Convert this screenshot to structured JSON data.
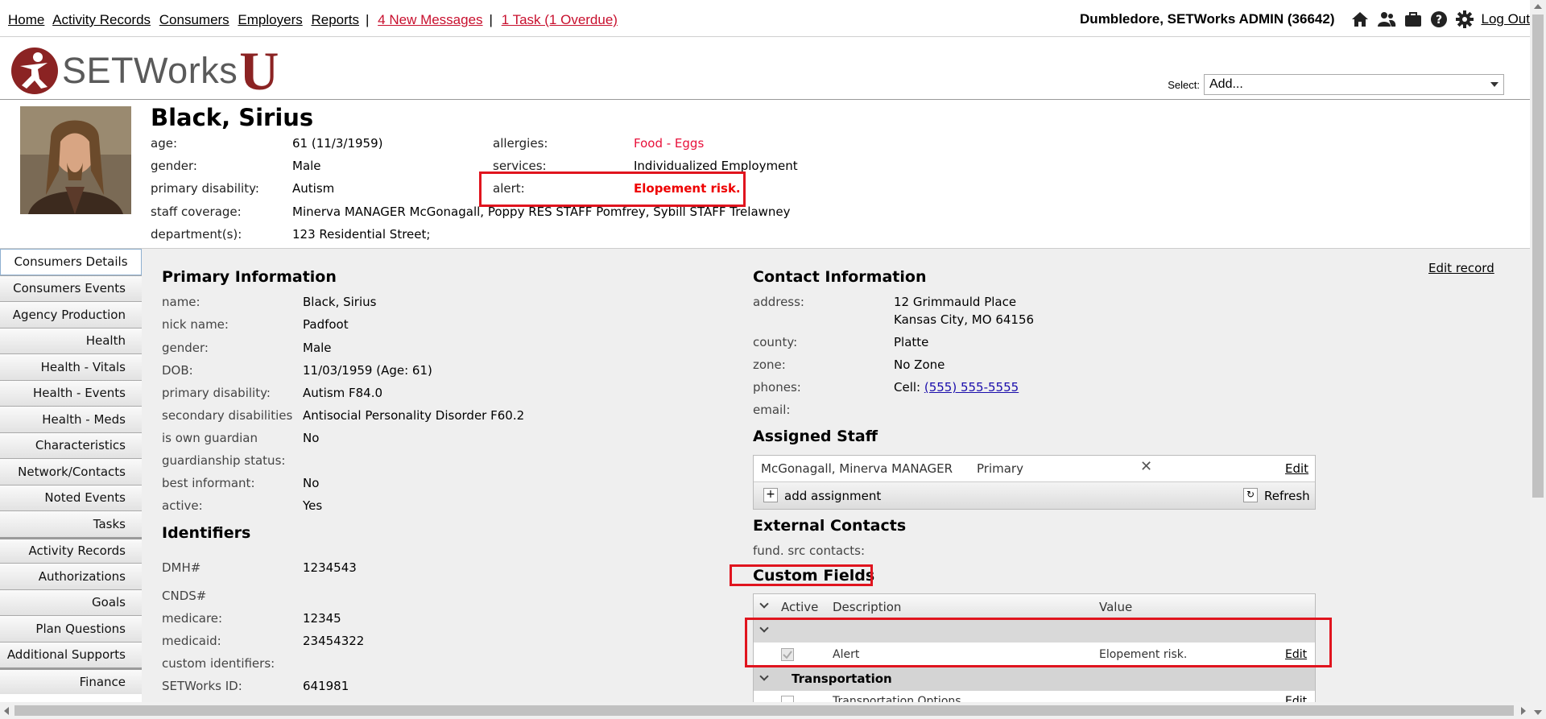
{
  "topnav": {
    "links": [
      "Home",
      "Activity Records",
      "Consumers",
      "Employers",
      "Reports"
    ],
    "messages": "4 New Messages",
    "tasks": "1 Task (1 Overdue)",
    "separator": "|",
    "user": "Dumbledore, SETWorks ADMIN  (36642)",
    "logout": "Log Out",
    "icons": [
      "home-icon",
      "users-icon",
      "briefcase-icon",
      "help-icon",
      "gear-icon"
    ]
  },
  "logo": {
    "text": "SETWorks",
    "suffix": "U"
  },
  "select": {
    "label": "Select:",
    "value": "Add..."
  },
  "consumer": {
    "name": "Black, Sirius",
    "age_label": "age:",
    "age": "61 (11/3/1959)",
    "gender_label": "gender:",
    "gender": "Male",
    "disability_label": "primary disability:",
    "disability": "Autism",
    "staff_label": "staff coverage:",
    "staff": "Minerva MANAGER McGonagall, Poppy RES STAFF Pomfrey, Sybill STAFF Trelawney",
    "dept_label": "department(s):",
    "dept": "123 Residential Street;",
    "allergies_label": "allergies:",
    "allergies": "Food - Eggs",
    "services_label": "services:",
    "services": "Individualized Employment",
    "alert_label": "alert:",
    "alert": "Elopement risk."
  },
  "sidebar": {
    "items": [
      "Consumers Details",
      "Consumers Events",
      "Agency Production",
      "Health",
      "Health - Vitals",
      "Health - Events",
      "Health - Meds",
      "Characteristics",
      "Network/Contacts",
      "Noted Events",
      "Tasks",
      "Activity Records",
      "Authorizations",
      "Goals",
      "Plan Questions",
      "Additional Supports",
      "Finance"
    ]
  },
  "primary": {
    "title": "Primary Information",
    "fields": [
      {
        "label": "name:",
        "value": "Black, Sirius"
      },
      {
        "label": "nick name:",
        "value": "Padfoot"
      },
      {
        "label": "gender:",
        "value": "Male"
      },
      {
        "label": "DOB:",
        "value": "11/03/1959 (Age: 61)"
      },
      {
        "label": "primary disability:",
        "value": "Autism F84.0"
      },
      {
        "label": "secondary disabilities",
        "value": "Antisocial Personality Disorder F60.2"
      },
      {
        "label": "is own guardian",
        "value": "No"
      },
      {
        "label": "guardianship status:",
        "value": ""
      },
      {
        "label": "best informant:",
        "value": "No"
      },
      {
        "label": "active:",
        "value": "Yes"
      }
    ]
  },
  "identifiers": {
    "title": "Identifiers",
    "dmh_label": "DMH#",
    "dmh": "1234543",
    "cnds_label": "CNDS#",
    "medicare_label": "medicare:",
    "medicare": "12345",
    "medicaid_label": "medicaid:",
    "medicaid": "23454322",
    "custom_label": "custom identifiers:",
    "setworks_label": "SETWorks ID:",
    "setworks": "641981"
  },
  "contact": {
    "title": "Contact Information",
    "edit_record": "Edit record",
    "address_label": "address:",
    "address1": "12 Grimmauld Place",
    "address2": "Kansas City, MO 64156",
    "county_label": "county:",
    "county": "Platte",
    "zone_label": "zone:",
    "zone": "No Zone",
    "phones_label": "phones:",
    "phone_prefix": "Cell: ",
    "phone": "(555) 555-5555",
    "email_label": "email:"
  },
  "staff": {
    "title": "Assigned Staff",
    "name": "McGonagall, Minerva MANAGER",
    "role": "Primary",
    "edit": "Edit",
    "add": "add assignment",
    "refresh": "Refresh"
  },
  "external": {
    "title": "External Contacts",
    "fund_label": "fund. src contacts:"
  },
  "custom": {
    "title": "Custom Fields",
    "headers": [
      "Active",
      "Description",
      "Value"
    ],
    "row_desc": "Alert",
    "row_value": "Elopement risk.",
    "row_edit": "Edit",
    "group2": "Transportation",
    "row2_desc": "Transportation Options",
    "row2_edit": "Edit"
  }
}
